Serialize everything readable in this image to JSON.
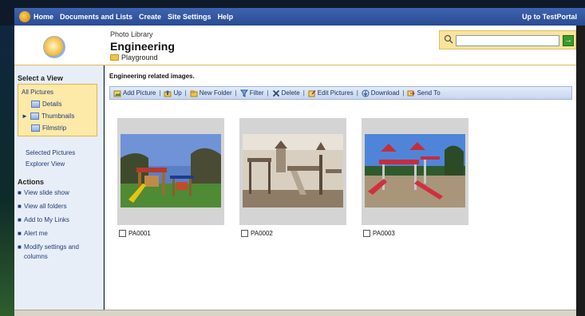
{
  "topbar": {
    "nav": [
      "Home",
      "Documents and Lists",
      "Create",
      "Site Settings",
      "Help"
    ],
    "portal_link": "Up to TestPortal"
  },
  "header": {
    "library_type": "Photo Library",
    "site_title": "Engineering",
    "folder": "Playground",
    "search_placeholder": "",
    "search_go": "→"
  },
  "sidebar": {
    "views_heading": "Select a View",
    "views": {
      "all": "All Pictures",
      "details": "Details",
      "thumbnails": "Thumbnails",
      "filmstrip": "Filmstrip"
    },
    "links": [
      "Selected Pictures",
      "Explorer View"
    ],
    "actions_heading": "Actions",
    "actions": [
      "View slide show",
      "View all folders",
      "Add to My Links",
      "Alert me",
      "Modify settings and columns"
    ]
  },
  "main": {
    "description": "Engineering related images.",
    "toolbar": [
      "Add Picture",
      "Up",
      "New Folder",
      "Filter",
      "Delete",
      "Edit Pictures",
      "Download",
      "Send To"
    ],
    "thumbnails": [
      {
        "name": "PA0001"
      },
      {
        "name": "PA0002"
      },
      {
        "name": "PA0003"
      }
    ]
  },
  "colors": {
    "topbar": "#2f519b",
    "views_highlight": "#fde9a8",
    "link": "#1f3c7a",
    "toolbar_bg": "#d3e0f3"
  }
}
